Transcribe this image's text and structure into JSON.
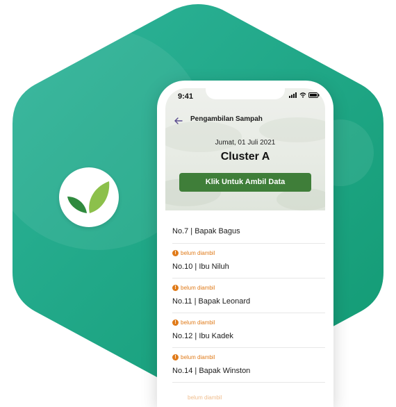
{
  "colors": {
    "brand_green": "#1f9a7f",
    "button_green": "#3f7e39",
    "warning_orange": "#e07b1a"
  },
  "status_bar": {
    "time": "9:41"
  },
  "header": {
    "back_icon": "arrow-left-icon",
    "title": "Pengambilan Sampah",
    "date": "Jumat, 01 Juli 2021",
    "cluster": "Cluster A",
    "cta_label": "Klik Untuk Ambil Data"
  },
  "list": {
    "items": [
      {
        "status": "",
        "name": "No.7 | Bapak Bagus"
      },
      {
        "status": "belum diambil",
        "name": "No.10 | Ibu Niluh"
      },
      {
        "status": "belum diambil",
        "name": "No.11 | Bapak Leonard"
      },
      {
        "status": "belum diambil",
        "name": "No.12 | Ibu Kadek"
      },
      {
        "status": "belum diambil",
        "name": "No.14 | Bapak Winston"
      }
    ],
    "peek_status": "belum diambil"
  }
}
